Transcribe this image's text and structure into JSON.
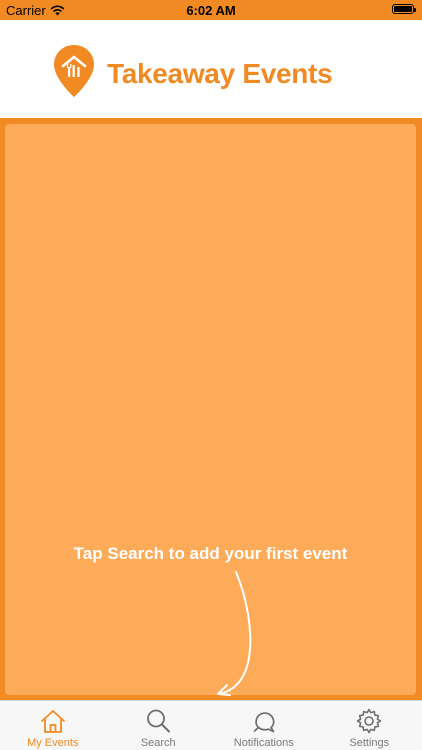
{
  "status_bar": {
    "carrier": "Carrier",
    "time": "6:02 AM"
  },
  "header": {
    "brand_name": "Takeaway Events"
  },
  "content": {
    "hint": "Tap Search to add your first event"
  },
  "tabs": [
    {
      "label": "My Events",
      "icon": "home-icon",
      "active": true
    },
    {
      "label": "Search",
      "icon": "search-icon",
      "active": false
    },
    {
      "label": "Notifications",
      "icon": "bell-icon",
      "active": false
    },
    {
      "label": "Settings",
      "icon": "gear-icon",
      "active": false
    }
  ],
  "colors": {
    "brand": "#f28a23",
    "panel": "#fdab59",
    "tab_inactive": "#7a7a7a"
  }
}
